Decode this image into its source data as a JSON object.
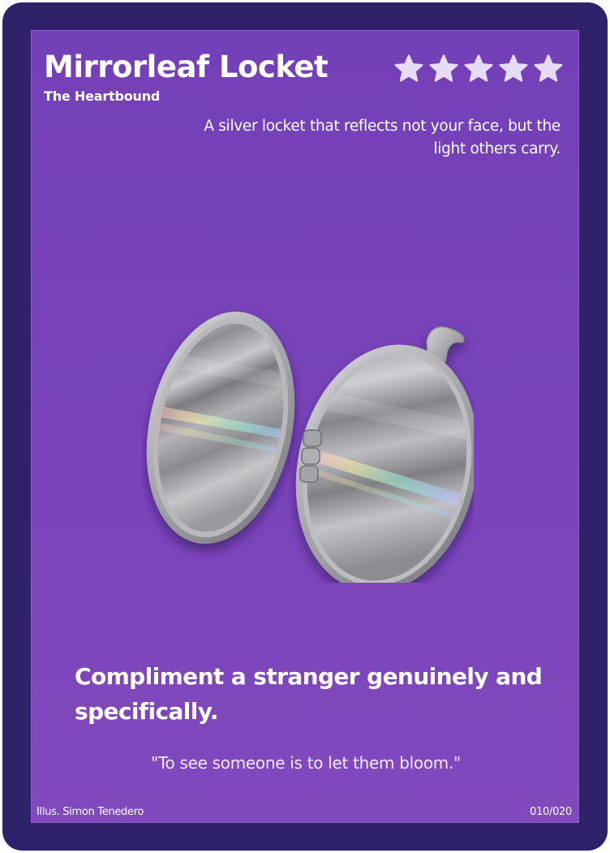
{
  "card": {
    "title": "Mirrorleaf Locket",
    "subtitle": "The Heartbound",
    "rating": 5,
    "rating_max": 5,
    "tagline": "A silver locket that reflects not your face, but the light others carry.",
    "illustration": "open-silver-locket",
    "prompt": "Compliment a stranger genuinely and specifically.",
    "quote": "\"To see someone is to let them bloom.\"",
    "illustrator": "Illus. Simon Tenedero",
    "number": "010/020"
  },
  "colors": {
    "frame": "#30226a",
    "card_background": "#7440b8",
    "text": "#ffffff",
    "star": "#e6dcf7"
  }
}
